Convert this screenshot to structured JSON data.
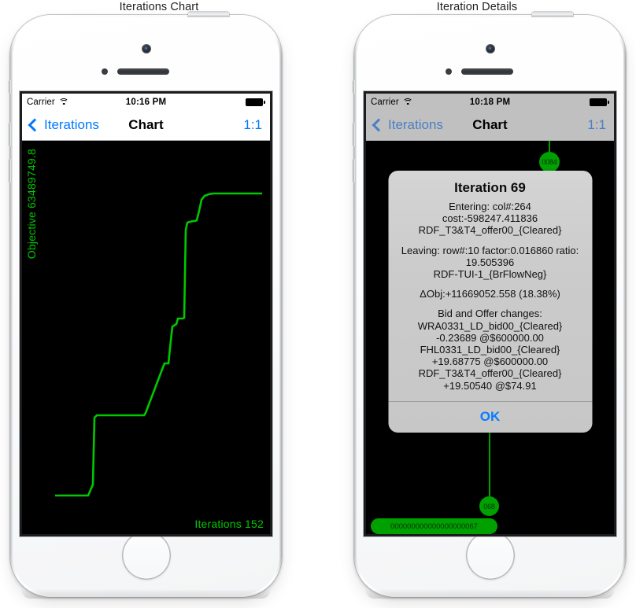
{
  "captions": {
    "left": "Iterations Chart",
    "right": "Iteration Details"
  },
  "left_phone": {
    "status_bar": {
      "carrier": "Carrier",
      "wifi_icon": "wifi-icon",
      "time": "10:16 PM",
      "battery_icon": "battery-full-icon"
    },
    "nav_bar": {
      "back_icon": "chevron-left-icon",
      "back_label": "Iterations",
      "title": "Chart",
      "right_label": "1:1"
    },
    "chart_colors": {
      "background": "#000000",
      "line": "#00c800",
      "text": "#00c800"
    }
  },
  "right_phone": {
    "status_bar": {
      "carrier": "Carrier",
      "wifi_icon": "wifi-icon",
      "time": "10:18 PM",
      "battery_icon": "battery-full-icon"
    },
    "nav_bar": {
      "back_icon": "chevron-left-icon",
      "back_label": "Iterations",
      "title": "Chart",
      "right_label": "1:1"
    },
    "graph_nodes": {
      "top_node": "0084",
      "mid_node": "068",
      "chain_label": "000000000000000000067"
    },
    "alert": {
      "title": "Iteration 69",
      "paragraphs": [
        "Entering: col#:264\ncost:-598247.411836\nRDF_T3&T4_offer00_{Cleared}",
        "Leaving: row#:10 factor:0.016860 ratio: 19.505396\nRDF-TUI-1_{BrFlowNeg}",
        "ΔObj:+11669052.558 (18.38%)",
        "Bid and Offer changes:\nWRA0331_LD_bid00_{Cleared}\n-0.23689 @$600000.00\nFHL0331_LD_bid00_{Cleared}\n+19.68775 @$600000.00\nRDF_T3&T4_offer00_{Cleared}\n+19.50540 @$74.91"
      ],
      "ok_label": "OK"
    }
  },
  "chart_data": {
    "type": "line",
    "title": "Iterations Chart",
    "xlabel": "Iterations  152",
    "ylabel": "Objective  63489749.8",
    "x_axis_text": "Iterations  152",
    "y_axis_text": "Objective  63489749.8",
    "xlim": [
      0,
      152
    ],
    "ylim": [
      0,
      63489749.8
    ],
    "grid": false,
    "legend": "none",
    "line_color": "#00c800",
    "background": "#000000",
    "step_style": "step-after",
    "x": [
      0,
      16,
      17,
      22,
      22.5,
      52,
      53,
      62,
      62.5,
      66,
      67,
      68,
      68.5,
      69,
      69.5,
      82,
      83,
      88,
      89,
      92,
      93,
      95,
      96,
      152
    ],
    "y": [
      2.0,
      2.0,
      2.2,
      15.0,
      15.2,
      15.2,
      16.0,
      31.0,
      31.2,
      31.2,
      34.0,
      36.5,
      36.6,
      36.8,
      38.0,
      38.0,
      82.5,
      82.6,
      83.2,
      83.2,
      88.5,
      91.0,
      95.0,
      95.0
    ],
    "y_units": "percent of y-axis maximum",
    "points_note": "Monotonically increasing objective step function over 152 simplex iterations"
  }
}
